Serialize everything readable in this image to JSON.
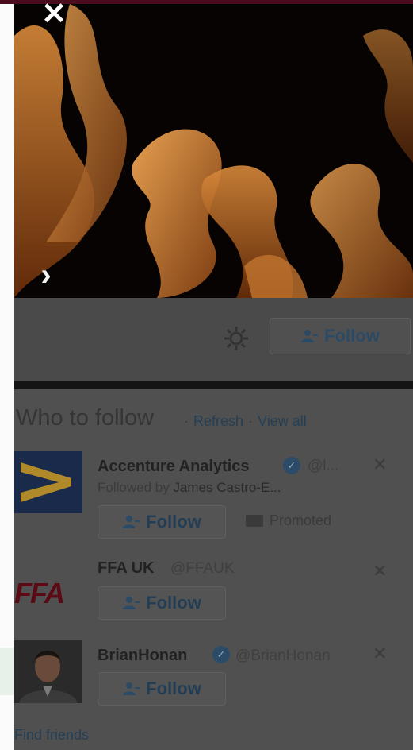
{
  "header": {
    "close_glyph": "✕",
    "next_glyph": "›",
    "follow_label": "Follow"
  },
  "who_to_follow": {
    "title": "Who to follow",
    "separator": "·",
    "refresh_label": "Refresh",
    "view_all_label": "View all",
    "accounts": [
      {
        "name": "Accenture Analytics",
        "handle": "@l...",
        "verified": true,
        "followed_by_prefix": "Followed by",
        "followed_by_name": "James Castro-E...",
        "follow_label": "Follow",
        "promoted_label": "Promoted",
        "dismiss_glyph": "✕"
      },
      {
        "name": "FFA UK",
        "handle": "@FFAUK",
        "verified": false,
        "logo_text": "FFA",
        "follow_label": "Follow",
        "dismiss_glyph": "✕"
      },
      {
        "name": "BrianHonan",
        "handle": "@BrianHonan",
        "verified": true,
        "follow_label": "Follow",
        "dismiss_glyph": "✕"
      }
    ],
    "find_friends_label": "Find friends"
  },
  "colors": {
    "accent_blue": "#243f55",
    "overlay": "#505050",
    "flame": "#b86a22"
  }
}
